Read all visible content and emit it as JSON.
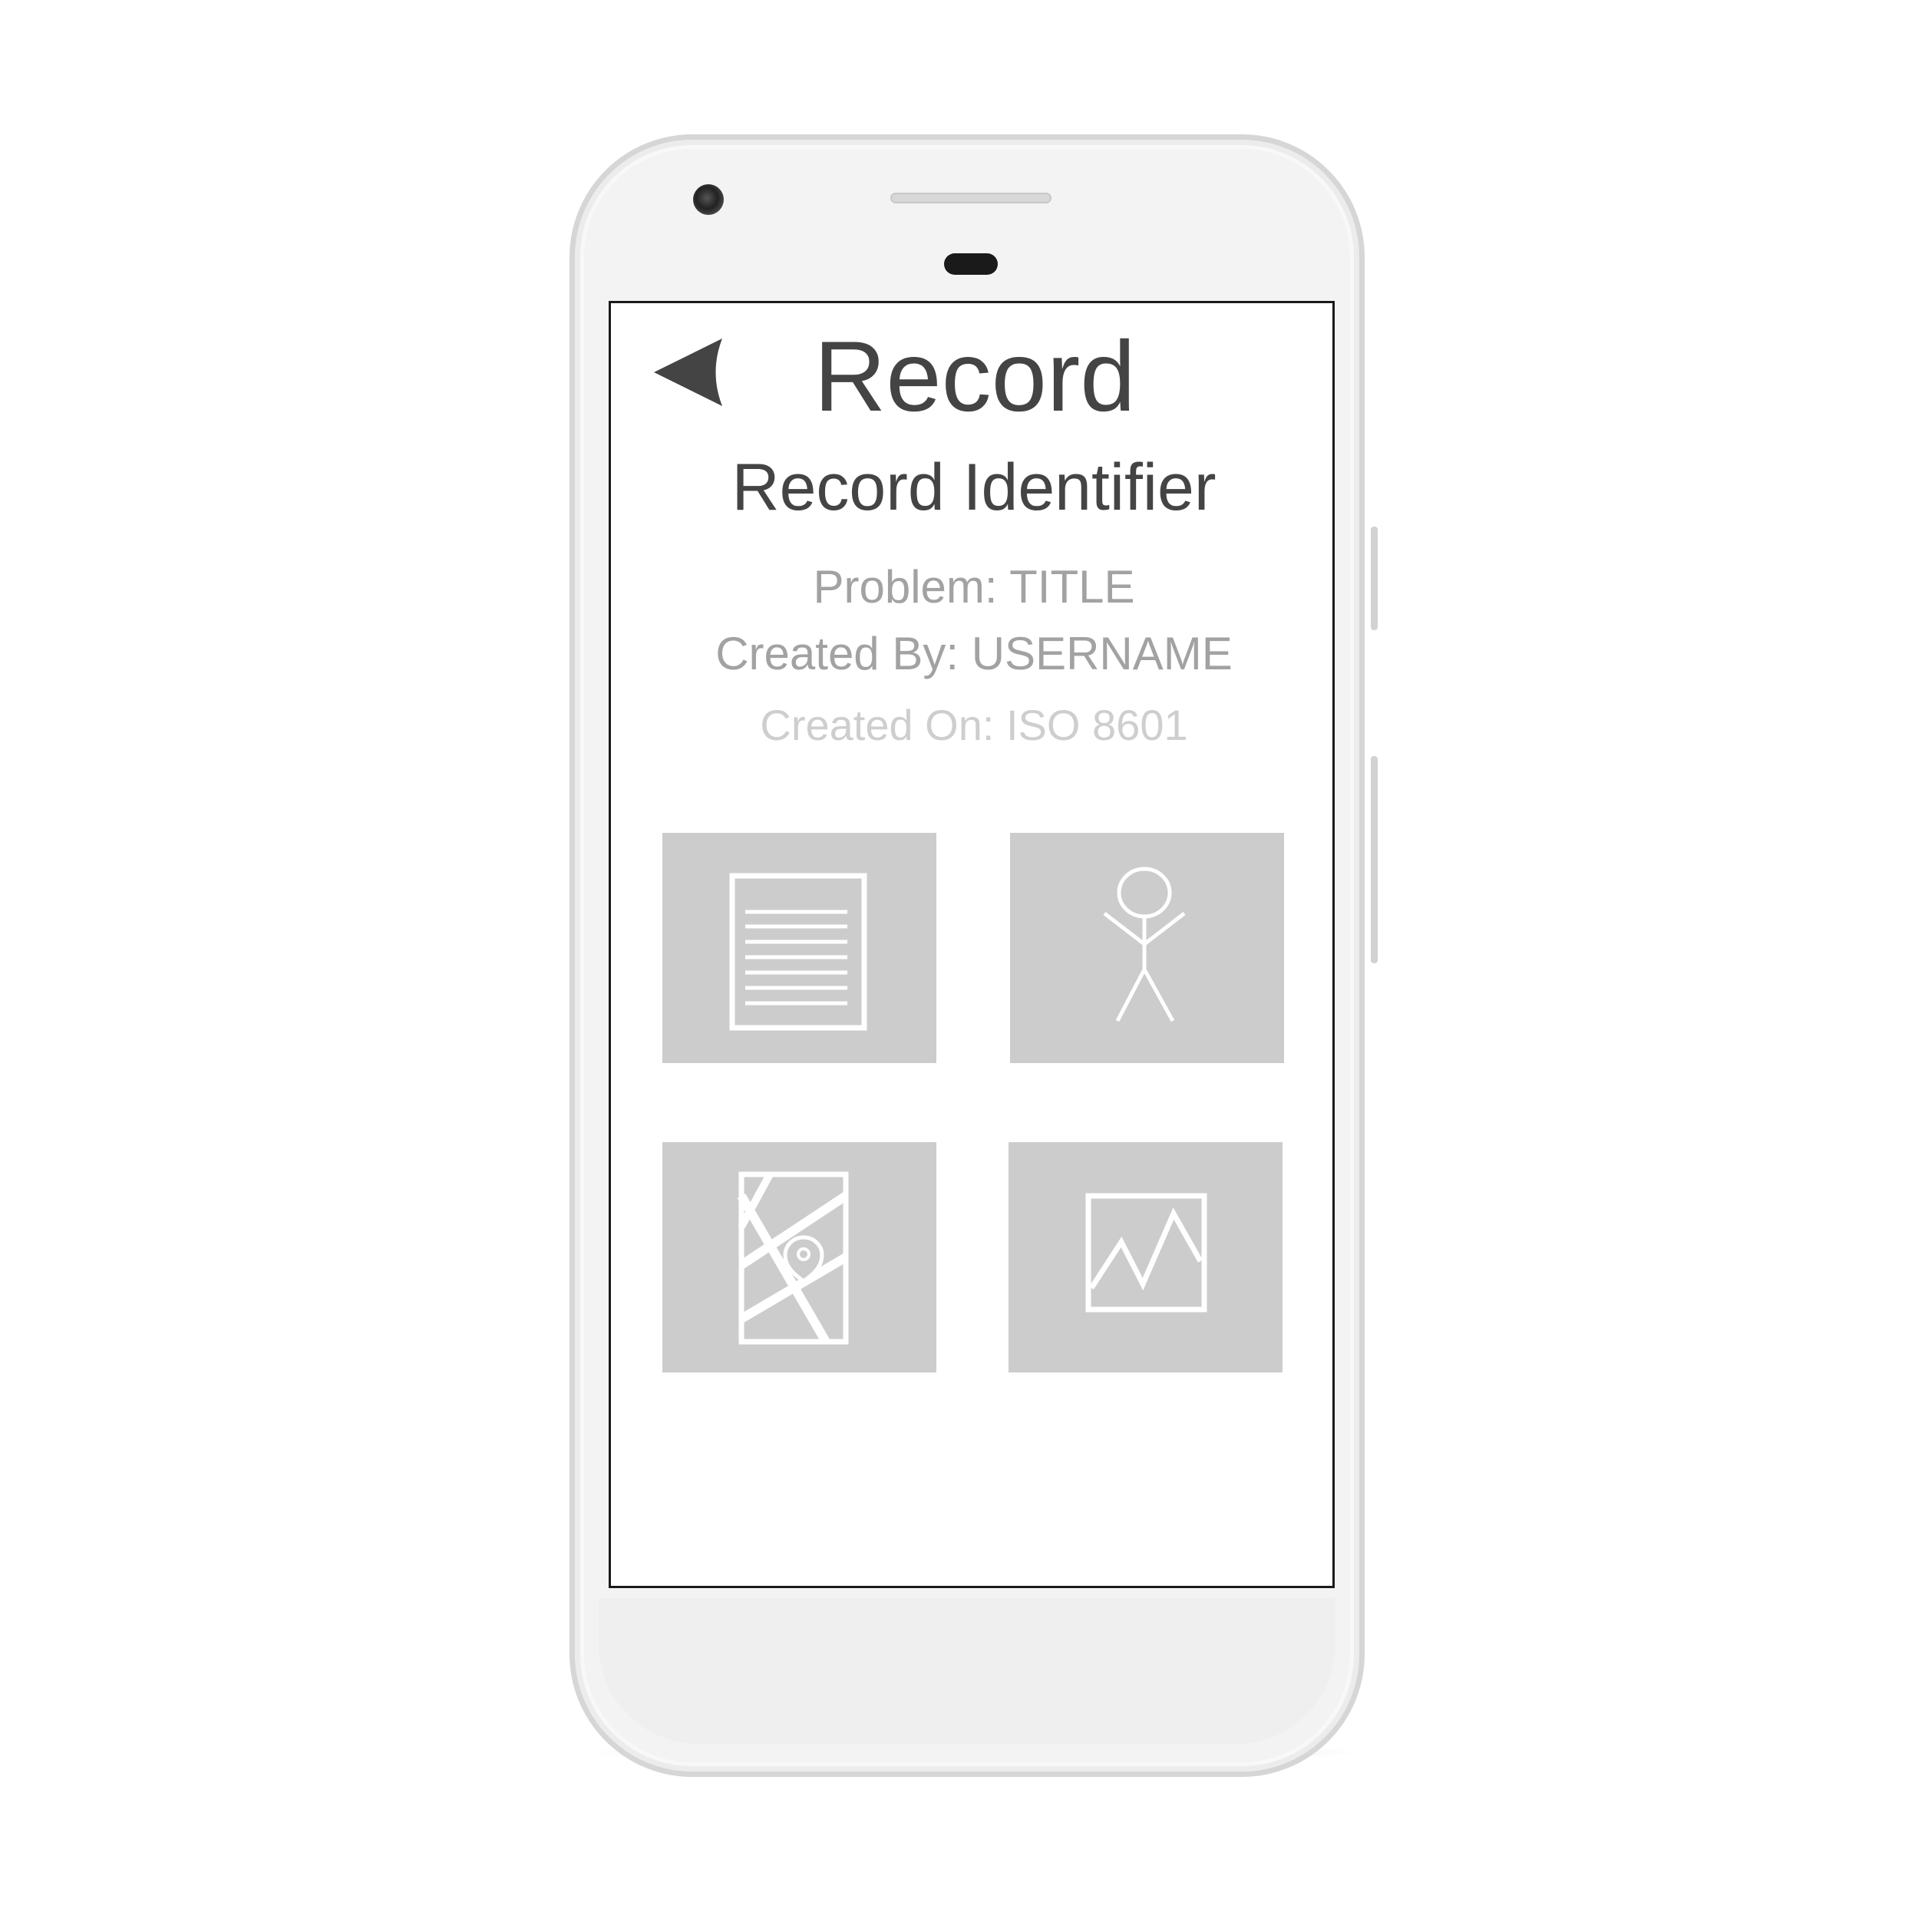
{
  "device": {
    "frame_color": "#f3f3f3",
    "screen_border_color": "#1a1a1a"
  },
  "header": {
    "back_icon": "back-arrow-icon",
    "title": "Record"
  },
  "record": {
    "identifier": "Record Identifier",
    "problem": "Problem: TITLE",
    "created_by": "Created By: USERNAME",
    "created_on": "Created On: ISO 8601"
  },
  "tiles": [
    {
      "icon": "document-icon"
    },
    {
      "icon": "person-icon"
    },
    {
      "icon": "map-pin-icon"
    },
    {
      "icon": "line-chart-icon"
    }
  ],
  "colors": {
    "title_text": "#444444",
    "meta_text": "#a2a2a2",
    "meta_light_text": "#cecece",
    "tile_background": "#cccccc",
    "icon_stroke": "#ffffff"
  }
}
